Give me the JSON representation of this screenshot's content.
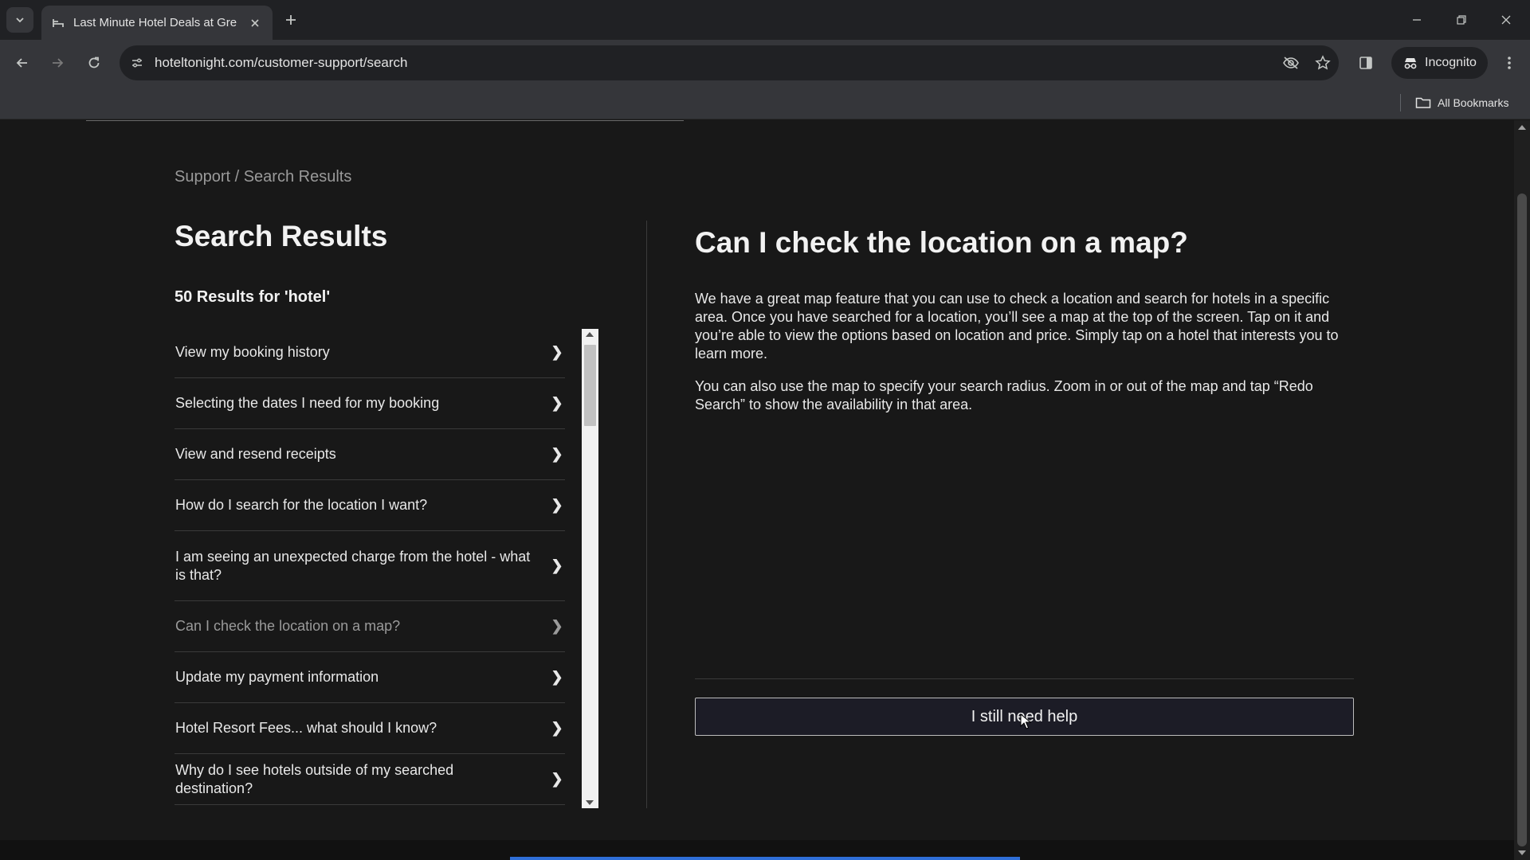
{
  "browser": {
    "tab_title": "Last Minute Hotel Deals at Gre",
    "url": "hoteltonight.com/customer-support/search",
    "incognito_label": "Incognito",
    "bookmarks_label": "All Bookmarks"
  },
  "page": {
    "breadcrumb": "Support / Search Results",
    "results_title": "Search Results",
    "results_count": "50 Results for 'hotel'",
    "results": [
      {
        "label": "View my booking history",
        "chevron": "❯"
      },
      {
        "label": "Selecting the dates I need for my booking",
        "chevron": "❯"
      },
      {
        "label": "View and resend receipts",
        "chevron": "❯"
      },
      {
        "label": "How do I search for the location I want?",
        "chevron": "❯"
      },
      {
        "label": "I am seeing an unexpected charge from the hotel - what is that?",
        "chevron": "❯"
      },
      {
        "label": "Can I check the location on a map?",
        "chevron": "❯",
        "active": true
      },
      {
        "label": "Update my payment information",
        "chevron": "❯"
      },
      {
        "label": "Hotel Resort Fees... what should I know?",
        "chevron": "❯"
      },
      {
        "label": "Why do I see hotels outside of my searched destination?",
        "chevron": "❯"
      }
    ],
    "article": {
      "title": "Can I check the location on a map?",
      "paragraph_1": "We have a great map feature that you can use to check a location and search for hotels in a specific area. Once you have searched for a location, you’ll see a map at the top of the screen. Tap on it and you’re able to view the options based on location and price. Simply tap on a hotel that interests you to learn more.",
      "paragraph_2": "You can also use the map to specify your search radius. Zoom in or out of the map and tap “Redo Search” to show the availability in that area.",
      "help_button": "I still need help"
    }
  }
}
